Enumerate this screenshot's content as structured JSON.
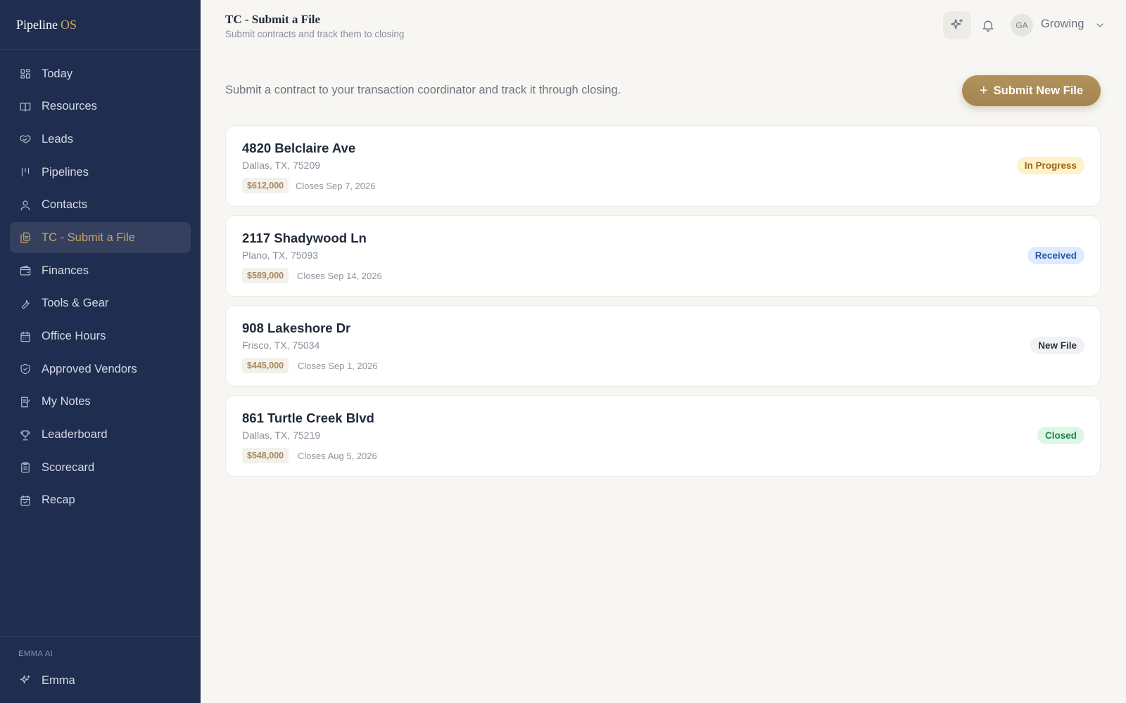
{
  "brand": {
    "name": "Pipeline",
    "accent": "OS"
  },
  "sidebar": {
    "items": [
      {
        "label": "Today",
        "icon": "grid-icon"
      },
      {
        "label": "Resources",
        "icon": "book-icon"
      },
      {
        "label": "Leads",
        "icon": "handshake-icon"
      },
      {
        "label": "Pipelines",
        "icon": "bars-icon"
      },
      {
        "label": "Contacts",
        "icon": "user-icon"
      },
      {
        "label": "TC - Submit a File",
        "icon": "files-icon",
        "active": true
      },
      {
        "label": "Finances",
        "icon": "wallet-icon"
      },
      {
        "label": "Tools & Gear",
        "icon": "wrench-icon"
      },
      {
        "label": "Office Hours",
        "icon": "calendar-icon"
      },
      {
        "label": "Approved Vendors",
        "icon": "shield-icon"
      },
      {
        "label": "My Notes",
        "icon": "notes-icon"
      },
      {
        "label": "Leaderboard",
        "icon": "trophy-icon"
      },
      {
        "label": "Scorecard",
        "icon": "clipboard-icon"
      },
      {
        "label": "Recap",
        "icon": "calendar-check-icon"
      }
    ],
    "footer_label": "EMMA AI",
    "footer_item": "Emma"
  },
  "header": {
    "title": "TC - Submit a File",
    "subtitle": "Submit contracts and track them to closing",
    "avatar_initials": "GA",
    "user_name": "Growing"
  },
  "main": {
    "intro": "Submit a contract to your transaction coordinator and track it through closing.",
    "submit_label": "Submit New File",
    "files": [
      {
        "address": "4820 Belclaire Ave",
        "city": "Dallas, TX, 75209",
        "price": "$612,000",
        "closes": "Closes Sep 7, 2026",
        "status": "In Progress"
      },
      {
        "address": "2117 Shadywood Ln",
        "city": "Plano, TX, 75093",
        "price": "$589,000",
        "closes": "Closes Sep 14, 2026",
        "status": "Received"
      },
      {
        "address": "908 Lakeshore Dr",
        "city": "Frisco, TX, 75034",
        "price": "$445,000",
        "closes": "Closes Sep 1, 2026",
        "status": "New File"
      },
      {
        "address": "861 Turtle Creek Blvd",
        "city": "Dallas, TX, 75219",
        "price": "$548,000",
        "closes": "Closes Aug 5, 2026",
        "status": "Closed"
      }
    ]
  },
  "colors": {
    "sidebar_bg": "#1f2d50",
    "accent_gold": "#c9a469",
    "button_gold": "#a98a55"
  }
}
